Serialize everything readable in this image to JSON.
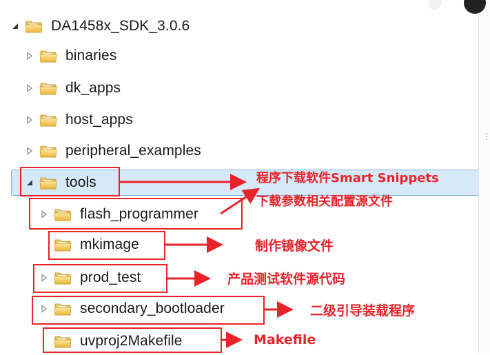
{
  "tree": {
    "root": {
      "label": "DA1458x_SDK_3.0.6",
      "expanded": true
    },
    "items": [
      {
        "label": "binaries",
        "expanded": false
      },
      {
        "label": "dk_apps",
        "expanded": false
      },
      {
        "label": "host_apps",
        "expanded": false
      },
      {
        "label": "peripheral_examples",
        "expanded": false
      },
      {
        "label": "tools",
        "expanded": true,
        "selected": true
      },
      {
        "label": "flash_programmer",
        "expanded": false
      },
      {
        "label": "mkimage",
        "expanded": false
      },
      {
        "label": "prod_test",
        "expanded": false
      },
      {
        "label": "secondary_bootloader",
        "expanded": false
      },
      {
        "label": "uvproj2Makefile",
        "expanded": false
      }
    ]
  },
  "annotations": {
    "tools": "程序下载软件Smart Snippets",
    "flash_programmer": "下载参数相关配置源文件",
    "mkimage": "制作镜像文件",
    "prod_test": "产品测试软件源代码",
    "secondary_bootloader": "二级引导装载程序",
    "uvproj2Makefile": "Makefile"
  },
  "colors": {
    "annotation_red": "#e8242a",
    "selection_bg": "#d6e9fb",
    "folder_yellow": "#f4c247"
  }
}
